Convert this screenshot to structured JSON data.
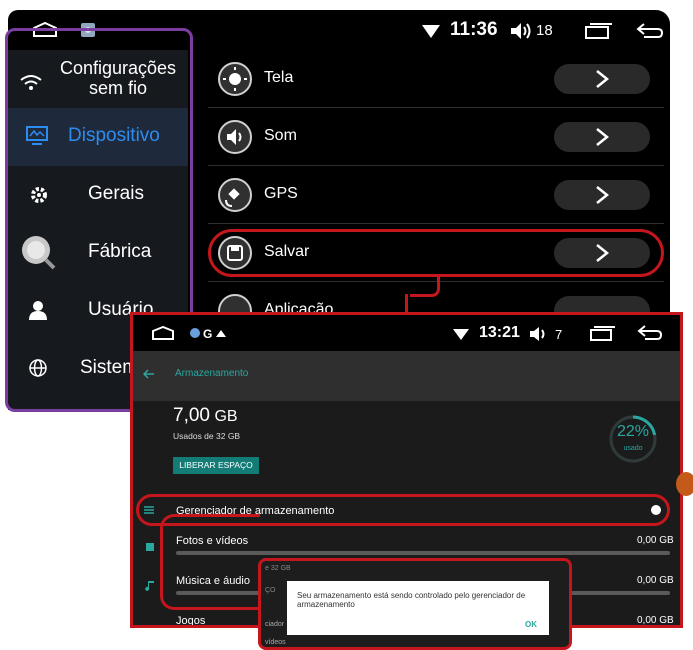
{
  "screen1": {
    "status": {
      "time": "11:36",
      "volume": "18"
    },
    "sidebar": [
      {
        "label": "Configurações sem fio",
        "icon": "wifi-icon"
      },
      {
        "label": "Dispositivo",
        "icon": "device-icon"
      },
      {
        "label": "Gerais",
        "icon": "gear-icon"
      },
      {
        "label": "Fábrica",
        "icon": "factory-icon"
      },
      {
        "label": "Usuário",
        "icon": "user-icon"
      },
      {
        "label": "Sistema",
        "icon": "globe-icon"
      }
    ],
    "menu": [
      {
        "label": "Tela",
        "icon": "brightness-icon"
      },
      {
        "label": "Som",
        "icon": "speaker-icon"
      },
      {
        "label": "GPS",
        "icon": "satellite-icon"
      },
      {
        "label": "Salvar",
        "icon": "save-icon"
      },
      {
        "label": "Aplicação",
        "icon": "android-icon"
      }
    ]
  },
  "screen2": {
    "status": {
      "time": "13:21",
      "volume": "7"
    },
    "appbar_title": "Armazenamento",
    "used_amount": "7,00",
    "used_unit": "GB",
    "used_of": "Usados de 32 GB",
    "free_button": "LIBERAR ESPAÇO",
    "percent": "22%",
    "percent_label": "usado",
    "percent_value": 0.22,
    "manager_label": "Gerenciador de armazenamento",
    "rows": [
      {
        "label": "Fotos e vídeos",
        "value": "0,00 GB"
      },
      {
        "label": "Música e áudio",
        "value": "0,00 GB"
      },
      {
        "label": "Jogos",
        "value": "0,00 GB"
      }
    ]
  },
  "screen3": {
    "bg_lines": [
      "e 32 GB",
      "ÇO",
      "ciador",
      "vídeos"
    ],
    "dialog_message": "Seu armazenamento está sendo controlado pelo gerenciador de armazenamento",
    "dialog_ok": "OK"
  },
  "colors": {
    "accent": "#2d8cf0",
    "teal": "#2aa7a0",
    "highlight": "#c4161c",
    "frame": "#7b3ea0"
  }
}
